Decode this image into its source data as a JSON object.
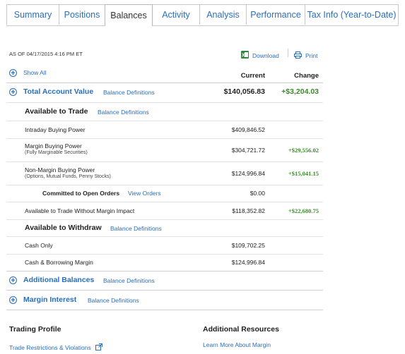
{
  "tabs": [
    {
      "label": "Summary",
      "active": false
    },
    {
      "label": "Positions",
      "active": false
    },
    {
      "label": "Balances",
      "active": true
    },
    {
      "label": "Activity",
      "active": false
    },
    {
      "label": "Analysis",
      "active": false
    },
    {
      "label": "Performance",
      "active": false
    },
    {
      "label": "Tax Info (Year-to-Date)",
      "active": false
    }
  ],
  "toolbar": {
    "as_of": "AS OF 04/17/2015 4:16 PM ET",
    "download": "Download",
    "print": "Print",
    "show_all": "Show All",
    "col_current": "Current",
    "col_change": "Change"
  },
  "total": {
    "label": "Total Account Value",
    "defs": "Balance Definitions",
    "current": "$140,056.83",
    "change": "+$3,204.03"
  },
  "available_to_trade": {
    "label": "Available to Trade",
    "defs": "Balance Definitions",
    "intraday": {
      "label": "Intraday Buying Power",
      "current": "$409,846.52"
    },
    "margin": {
      "label": "Margin Buying Power",
      "sub": "(Fully Marginable Securities)",
      "current": "$304,721.72",
      "change": "+$29,556.02"
    },
    "nonmargin": {
      "label": "Non-Margin Buying Power",
      "sub": "(Options, Mutual Funds, Penny Stocks)",
      "current": "$124,996.84",
      "change": "+$15,041.15"
    },
    "committed": {
      "label": "Committed to Open Orders",
      "link": "View Orders",
      "current": "$0.00"
    },
    "without_margin": {
      "label": "Available to Trade Without Margin Impact",
      "current": "$118,352.82",
      "change": "+$22,680.75"
    }
  },
  "available_to_withdraw": {
    "label": "Available to Withdraw",
    "defs": "Balance Definitions",
    "cash_only": {
      "label": "Cash Only",
      "current": "$109,702.25"
    },
    "cash_borrow": {
      "label": "Cash & Borrowing Margin",
      "current": "$124,996.84"
    }
  },
  "additional_balances": {
    "label": "Additional Balances",
    "defs": "Balance Definitions"
  },
  "margin_interest": {
    "label": "Margin Interest",
    "defs": "Balance Definitions"
  },
  "footer": {
    "trading_profile": "Trading Profile",
    "trade_restrictions": "Trade Restrictions & Violations",
    "additional_resources": "Additional Resources",
    "learn_margin": "Learn More About Margin"
  },
  "colors": {
    "link": "#2a6ebb",
    "positive": "#3a8a2a",
    "border": "#c8c8c8"
  },
  "icons": {
    "download": "excel-icon",
    "print": "printer-icon",
    "expand": "plus-circle-icon",
    "external": "external-link-icon"
  }
}
